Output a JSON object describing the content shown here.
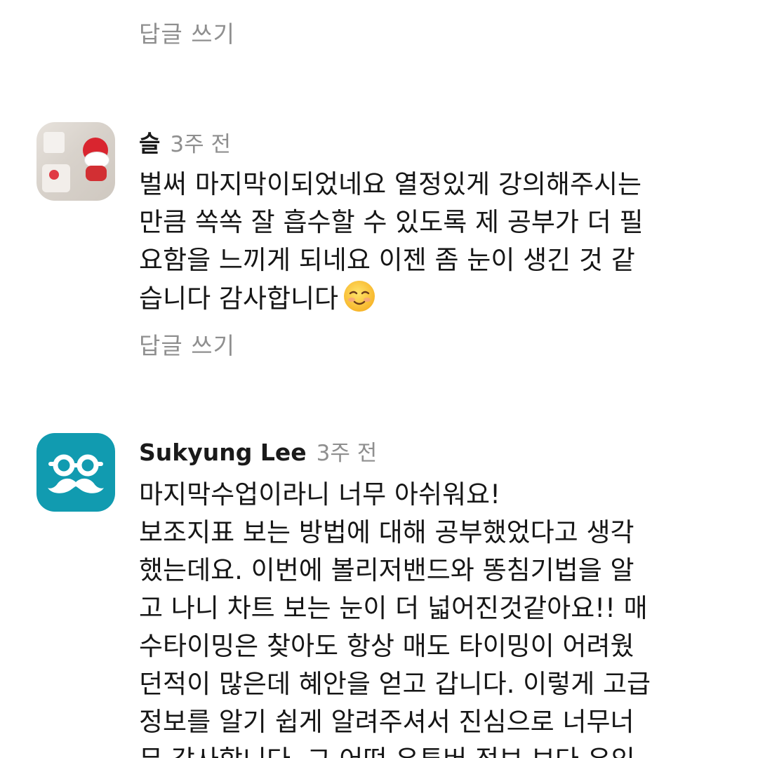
{
  "reply_label": "답글 쓰기",
  "comments": [
    {
      "author": "슬",
      "time": "3주 전",
      "avatar": "hello-kitty-photo",
      "lines": [
        "벌써 마지막이되었네요 열정있게 강의해주시는",
        "만큼 쏙쏙 잘 흡수할 수 있도록 제 공부가 더 필",
        "요함을 느끼게 되네요 이젠 좀 눈이 생긴 것 같",
        "습니다 감사합니다"
      ],
      "emoji": "smiling-face-icon"
    },
    {
      "author": "Sukyung Lee",
      "time": "3주 전",
      "avatar": "glasses-mustache-icon",
      "avatar_color": "#119bb0",
      "lines": [
        "마지막수업이라니 너무 아쉬워요!",
        "보조지표 보는 방법에 대해 공부했었다고 생각",
        "했는데요. 이번에 볼리저밴드와 똥침기법을 알",
        "고 나니 차트 보는 눈이 더 넓어진것같아요!! 매",
        "수타이밍은 찾아도 항상 매도 타이밍이 어려웠",
        "던적이 많은데 혜안을 얻고 갑니다. 이렇게 고급",
        "정보를 알기 쉽게 알려주셔서 진심으로 너무너",
        "무 감사합니다. 그 어떤 유튜버 정보 보다 유익"
      ]
    }
  ]
}
